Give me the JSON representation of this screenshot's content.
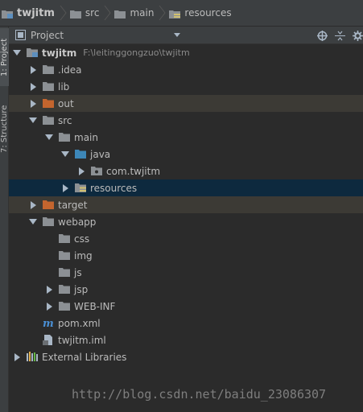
{
  "breadcrumb": [
    "twjitm",
    "src",
    "main",
    "resources"
  ],
  "tool_strip": {
    "project_tab": "1: Project",
    "structure_tab": "7: Structure"
  },
  "panel": {
    "view_label": "Project"
  },
  "tree": [
    {
      "label": "twjitm",
      "path": "F:\\leitinggongzuo\\twjitm",
      "depth": 0,
      "arrow": "down",
      "icon": "module"
    },
    {
      "label": ".idea",
      "depth": 1,
      "arrow": "right",
      "icon": "folder-gray"
    },
    {
      "label": "lib",
      "depth": 1,
      "arrow": "right",
      "icon": "folder-gray"
    },
    {
      "label": "out",
      "depth": 1,
      "arrow": "right",
      "icon": "folder-orange"
    },
    {
      "label": "src",
      "depth": 1,
      "arrow": "down",
      "icon": "folder-gray"
    },
    {
      "label": "main",
      "depth": 2,
      "arrow": "down",
      "icon": "folder-gray"
    },
    {
      "label": "java",
      "depth": 3,
      "arrow": "down",
      "icon": "folder-blue"
    },
    {
      "label": "com.twjitm",
      "depth": 4,
      "arrow": "right",
      "icon": "package"
    },
    {
      "label": "resources",
      "depth": 3,
      "arrow": "right",
      "icon": "resources"
    },
    {
      "label": "target",
      "depth": 1,
      "arrow": "right",
      "icon": "folder-orange"
    },
    {
      "label": "webapp",
      "depth": 1,
      "arrow": "down",
      "icon": "folder-gray"
    },
    {
      "label": "css",
      "depth": 2,
      "arrow": "none",
      "icon": "folder-gray"
    },
    {
      "label": "img",
      "depth": 2,
      "arrow": "none",
      "icon": "folder-gray"
    },
    {
      "label": "js",
      "depth": 2,
      "arrow": "none",
      "icon": "folder-gray"
    },
    {
      "label": "jsp",
      "depth": 2,
      "arrow": "right",
      "icon": "folder-gray"
    },
    {
      "label": "WEB-INF",
      "depth": 2,
      "arrow": "right",
      "icon": "folder-gray"
    },
    {
      "label": "pom.xml",
      "depth": 1,
      "arrow": "none",
      "icon": "maven"
    },
    {
      "label": "twjitm.iml",
      "depth": 1,
      "arrow": "none",
      "icon": "iml"
    },
    {
      "label": "External Libraries",
      "depth": 0,
      "arrow": "right",
      "icon": "libraries"
    }
  ],
  "watermark": "http://blog.csdn.net/baidu_23086307",
  "colors": {
    "folder_gray": "#8c9094",
    "folder_orange": "#c4652e",
    "folder_blue": "#3d87b8",
    "excluded_row": "#3c3a35",
    "selected_row": "#0d293e",
    "maven": "#4a8fd4"
  }
}
